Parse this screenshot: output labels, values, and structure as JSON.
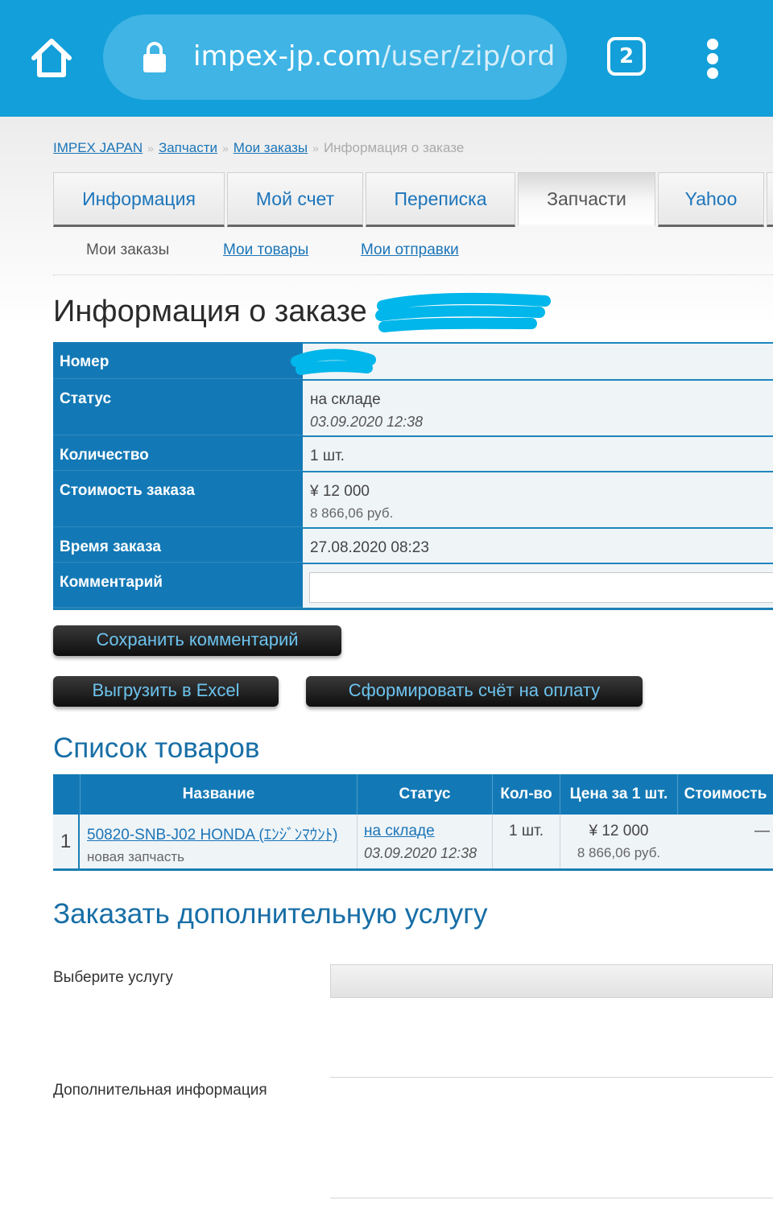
{
  "browser": {
    "url_host": "impex-jp.com",
    "url_path": "/user/zip/ord",
    "tab_count": "2",
    "home_icon": "home-icon",
    "lock_icon": "lock-icon",
    "menu_icon": "more-vert-icon"
  },
  "breadcrumb": {
    "items": [
      "IMPEX JAPAN",
      "Запчасти",
      "Мои заказы"
    ],
    "separator": "»",
    "current": "Информация о заказе"
  },
  "tabs": [
    {
      "label": "Информация",
      "active": false
    },
    {
      "label": "Мой счет",
      "active": false
    },
    {
      "label": "Переписка",
      "active": false
    },
    {
      "label": "Запчасти",
      "active": true
    },
    {
      "label": "Yahoo",
      "active": false
    }
  ],
  "subnav": [
    "Мои заказы",
    "Мои товары",
    "Мои отправки"
  ],
  "order": {
    "title": "Информация о заказе",
    "rows": {
      "number_label": "Номер",
      "status_label": "Статус",
      "status_value": "на складе",
      "status_date": "03.09.2020 12:38",
      "qty_label": "Количество",
      "qty_value": "1 шт.",
      "cost_label": "Стоимость заказа",
      "cost_yen": "¥ 12 000",
      "cost_rub": "8 866,06 руб.",
      "time_label": "Время заказа",
      "time_value": "27.08.2020 08:23",
      "comment_label": "Комментарий"
    }
  },
  "buttons": {
    "save_comment": "Сохранить комментарий",
    "export_excel": "Выгрузить в Excel",
    "make_invoice": "Сформировать счёт на оплату"
  },
  "goods": {
    "title": "Список товаров",
    "headers": [
      "Название",
      "Статус",
      "Кол-во",
      "Цена за 1 шт.",
      "Стоимость"
    ],
    "rows": [
      {
        "num": "1",
        "name": "50820-SNB-J02 HONDA (ｴﾝｼﾞﾝﾏｳﾝﾄ)",
        "note": "новая запчасть",
        "status": "на складе",
        "status_date": "03.09.2020 12:38",
        "qty": "1 шт.",
        "price_yen": "¥ 12 000",
        "price_rub": "8 866,06 руб.",
        "total": "—"
      }
    ]
  },
  "service": {
    "title": "Заказать дополнительную услугу",
    "select_label": "Выберите услугу",
    "info_label": "Дополнительная информация"
  },
  "colors": {
    "browser_bar": "#139fd9",
    "table_header": "#1379b6",
    "link": "#1b75b8",
    "button_text": "#6cc3ee",
    "redaction": "#00b6ea"
  }
}
